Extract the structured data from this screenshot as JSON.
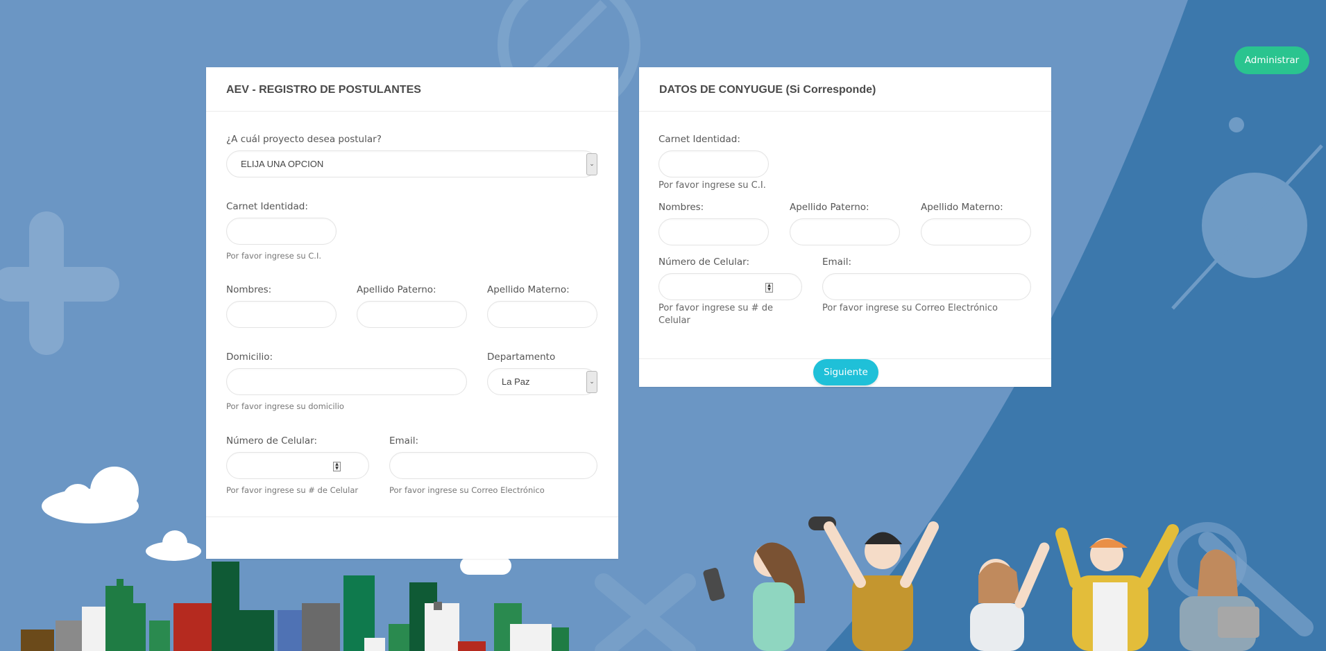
{
  "header": {
    "admin_button": "Administrar"
  },
  "left_card": {
    "title": "AEV - REGISTRO DE POSTULANTES",
    "project": {
      "label": "¿A cuál proyecto desea postular?",
      "selected": "ELIJA UNA OPCION"
    },
    "ci": {
      "label": "Carnet Identidad:",
      "help": "Por favor ingrese su C.I."
    },
    "nombres": {
      "label": "Nombres:"
    },
    "apellido_paterno": {
      "label": "Apellido Paterno:"
    },
    "apellido_materno": {
      "label": "Apellido Materno:"
    },
    "domicilio": {
      "label": "Domicilio:",
      "help": "Por favor ingrese su domicilio"
    },
    "departamento": {
      "label": "Departamento",
      "selected": "La Paz"
    },
    "celular": {
      "label": "Número de Celular:",
      "help": "Por favor ingrese su # de Celular"
    },
    "email": {
      "label": "Email:",
      "help": "Por favor ingrese su Correo Electrónico"
    }
  },
  "right_card": {
    "title": "DATOS DE CONYUGUE (Si Corresponde)",
    "ci": {
      "label": "Carnet Identidad:",
      "help": "Por favor ingrese su C.I."
    },
    "nombres": {
      "label": "Nombres:"
    },
    "apellido_paterno": {
      "label": "Apellido Paterno:"
    },
    "apellido_materno": {
      "label": "Apellido Materno:"
    },
    "celular": {
      "label": "Número de Celular:",
      "help_line1": "Por favor ingrese su # de",
      "help_line2": "Celular"
    },
    "email": {
      "label": "Email:",
      "help": "Por favor ingrese su Correo Electrónico"
    },
    "next_button": "Siguiente"
  },
  "colors": {
    "background": "#6b96c4",
    "arc": "#3d79ad",
    "admin_button": "#2ac48f",
    "next_button": "#1fc0d8"
  }
}
